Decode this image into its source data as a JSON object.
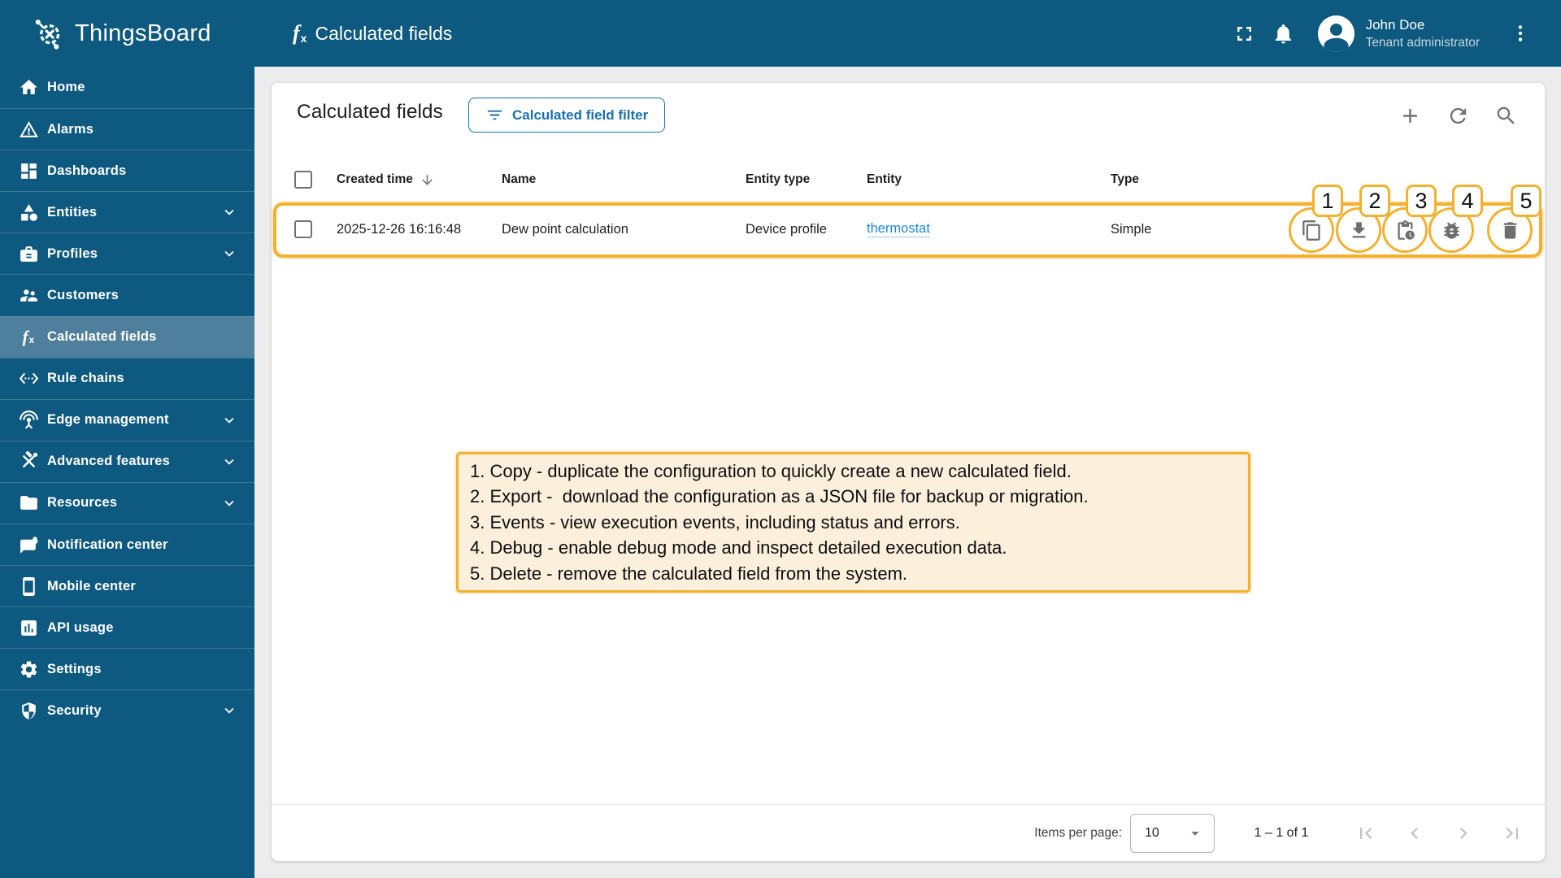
{
  "colors": {
    "primary": "#0d5980",
    "sidebar_selected": "#4e7f9c",
    "accent_blue": "#1a6fae",
    "link_blue": "#1e88d5",
    "annotation_yellow": "#f2b12e",
    "annotation_cream": "#fcefdc"
  },
  "icons": {
    "fx_f": "f",
    "fx_x": "x"
  },
  "brand": {
    "name": "ThingsBoard"
  },
  "header": {
    "page_title": "Calculated fields",
    "user": {
      "name": "John Doe",
      "role": "Tenant administrator"
    }
  },
  "sidebar": {
    "items": [
      {
        "label": "Home",
        "icon": "home-icon",
        "selected": false,
        "expandable": false
      },
      {
        "label": "Alarms",
        "icon": "alarm-warning-icon",
        "selected": false,
        "expandable": false
      },
      {
        "label": "Dashboards",
        "icon": "dashboard-icon",
        "selected": false,
        "expandable": false
      },
      {
        "label": "Entities",
        "icon": "category-icon",
        "selected": false,
        "expandable": true
      },
      {
        "label": "Profiles",
        "icon": "badge-icon",
        "selected": false,
        "expandable": true
      },
      {
        "label": "Customers",
        "icon": "people-icon",
        "selected": false,
        "expandable": false
      },
      {
        "label": "Calculated fields",
        "icon": "function-icon",
        "selected": true,
        "expandable": false
      },
      {
        "label": "Rule chains",
        "icon": "ethernet-icon",
        "selected": false,
        "expandable": false
      },
      {
        "label": "Edge management",
        "icon": "antenna-icon",
        "selected": false,
        "expandable": true
      },
      {
        "label": "Advanced features",
        "icon": "tools-icon",
        "selected": false,
        "expandable": true
      },
      {
        "label": "Resources",
        "icon": "folder-icon",
        "selected": false,
        "expandable": true
      },
      {
        "label": "Notification center",
        "icon": "notification-chat-icon",
        "selected": false,
        "expandable": false
      },
      {
        "label": "Mobile center",
        "icon": "smartphone-icon",
        "selected": false,
        "expandable": false
      },
      {
        "label": "API usage",
        "icon": "chart-icon",
        "selected": false,
        "expandable": false
      },
      {
        "label": "Settings",
        "icon": "gear-icon",
        "selected": false,
        "expandable": false
      },
      {
        "label": "Security",
        "icon": "shield-icon",
        "selected": false,
        "expandable": true
      }
    ]
  },
  "main": {
    "title": "Calculated fields",
    "filter_button_label": "Calculated field filter",
    "table": {
      "columns": {
        "created_time": "Created time",
        "name": "Name",
        "entity_type": "Entity type",
        "entity": "Entity",
        "type": "Type"
      },
      "row": {
        "created_time": "2025-12-26 16:16:48",
        "name": "Dew point calculation",
        "entity_type": "Device profile",
        "entity": "thermostat",
        "type": "Simple"
      }
    },
    "actions": [
      {
        "num": "1",
        "name": "copy"
      },
      {
        "num": "2",
        "name": "export-download"
      },
      {
        "num": "3",
        "name": "events"
      },
      {
        "num": "4",
        "name": "debug"
      },
      {
        "num": "5",
        "name": "delete"
      }
    ],
    "annotation": {
      "lines": [
        "1. Copy - duplicate the configuration to quickly create a new calculated field.",
        "2. Export -  download the configuration as a JSON file for backup or migration.",
        "3. Events - view execution events, including status and errors.",
        "4. Debug - enable debug mode and inspect detailed execution data.",
        "5. Delete - remove the calculated field from the system."
      ]
    },
    "pagination": {
      "items_per_page_label": "Items per page:",
      "page_size": "10",
      "range": "1 – 1 of 1"
    }
  }
}
